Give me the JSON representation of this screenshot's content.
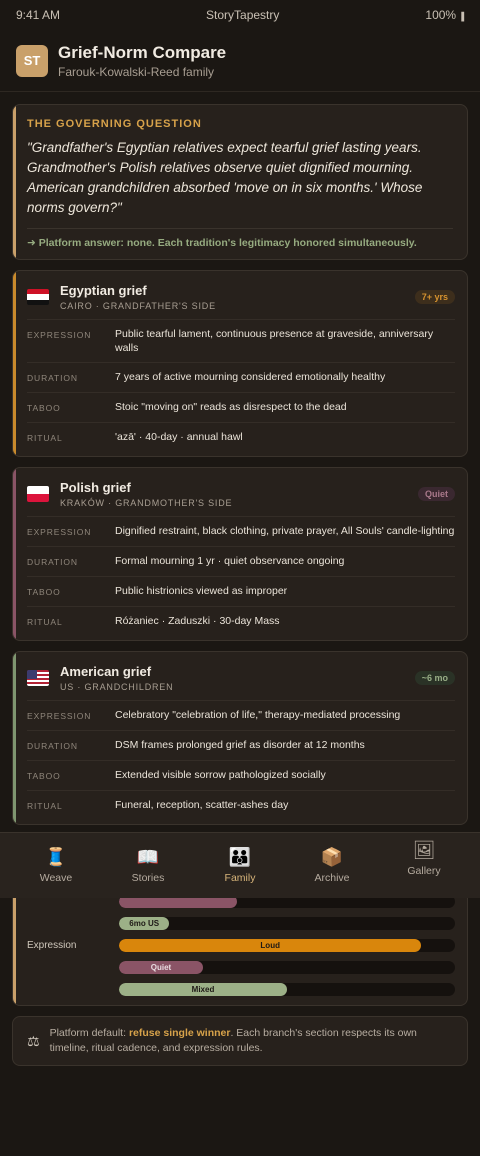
{
  "status": {
    "time": "9:41 AM",
    "carrier": "StoryTapestry",
    "battery": "100%"
  },
  "header": {
    "logo": "ST",
    "title": "Grief-Norm Compare",
    "subtitle": "Farouk-Kowalski-Reed family"
  },
  "question": {
    "label": "THE GOVERNING QUESTION",
    "text": "\"Grandfather's Egyptian relatives expect tearful grief lasting years. Grandmother's Polish relatives observe quiet dignified mourning. American grandchildren absorbed 'move on in six months.' Whose norms govern?\"",
    "answer": "➜ Platform answer: none. Each tradition's legitimacy honored simultaneously."
  },
  "cards": [
    {
      "title": "Egyptian grief",
      "subtitle": "CAIRO · GRANDFATHER'S SIDE",
      "badge": "7+ yrs",
      "rows": [
        {
          "label": "EXPRESSION",
          "value": "Public tearful lament, continuous presence at graveside, anniversary walls"
        },
        {
          "label": "DURATION",
          "value": "7 years of active mourning considered emotionally healthy"
        },
        {
          "label": "TABOO",
          "value": "Stoic \"moving on\" reads as disrespect to the dead"
        },
        {
          "label": "RITUAL",
          "value": "'azā' · 40-day · annual hawl"
        }
      ]
    },
    {
      "title": "Polish grief",
      "subtitle": "KRAKÓW · GRANDMOTHER'S SIDE",
      "badge": "Quiet",
      "rows": [
        {
          "label": "EXPRESSION",
          "value": "Dignified restraint, black clothing, private prayer, All Souls' candle-lighting"
        },
        {
          "label": "DURATION",
          "value": "Formal mourning 1 yr · quiet observance ongoing"
        },
        {
          "label": "TABOO",
          "value": "Public histrionics viewed as improper"
        },
        {
          "label": "RITUAL",
          "value": "Różaniec · Zaduszki · 30-day Mass"
        }
      ]
    },
    {
      "title": "American grief",
      "subtitle": "US · GRANDCHILDREN",
      "badge": "~6 mo",
      "rows": [
        {
          "label": "EXPRESSION",
          "value": "Celebratory \"celebration of life,\" therapy-mediated processing"
        },
        {
          "label": "DURATION",
          "value": "DSM frames prolonged grief as disorder at 12 months"
        },
        {
          "label": "TABOO",
          "value": "Extended visible sorrow pathologized socially"
        },
        {
          "label": "RITUAL",
          "value": "Funeral, reception, scatter-ashes day"
        }
      ]
    }
  ],
  "tabs": [
    {
      "label": "Weave",
      "icon": "spool-icon",
      "glyph": "🧵"
    },
    {
      "label": "Stories",
      "icon": "book-icon",
      "glyph": "📖"
    },
    {
      "label": "Family",
      "icon": "family-icon",
      "glyph": "👪"
    },
    {
      "label": "Archive",
      "icon": "box-icon",
      "glyph": "📦"
    },
    {
      "label": "Gallery",
      "icon": "picture-icon",
      "glyph": "🖼"
    }
  ],
  "bars": {
    "duration": {
      "value": "6mo US",
      "fraction": 0.15
    },
    "expression_label": "Expression",
    "expression": [
      {
        "value": "Loud",
        "fraction": 0.9
      },
      {
        "value": "Quiet",
        "fraction": 0.25
      },
      {
        "value": "Mixed",
        "fraction": 0.5
      }
    ]
  },
  "note": {
    "prefix": "Platform default: ",
    "bold": "refuse single winner",
    "suffix": ". Each branch's section respects its own timeline, ritual cadence, and expression rules."
  },
  "colors": {
    "egypt": "#c98a2c",
    "poland": "#8a5466",
    "us": "#7f9670",
    "accent": "#d7a24a"
  }
}
